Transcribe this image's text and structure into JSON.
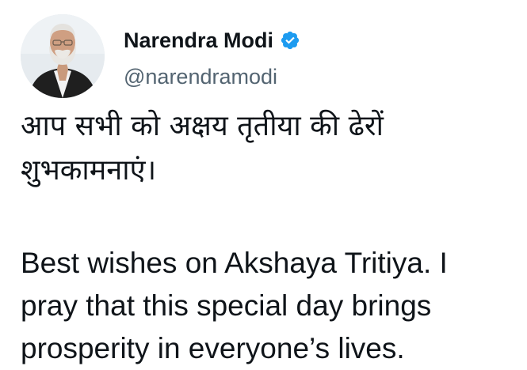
{
  "author": {
    "display_name": "Narendra Modi",
    "handle": "@narendramodi",
    "verified_icon": "verified-badge-icon",
    "verified_color": "#1d9bf0"
  },
  "tweet": {
    "hindi_lines": [
      "आप सभी को अक्षय तृतीया की ढेरों",
      "शुभकामनाएं।"
    ],
    "english_lines": [
      "Best wishes on Akshaya Tritiya. I",
      "pray that this special day brings",
      "prosperity in everyone’s lives."
    ]
  },
  "colors": {
    "text": "#0f1419",
    "secondary_text": "#536471",
    "background": "#ffffff"
  }
}
